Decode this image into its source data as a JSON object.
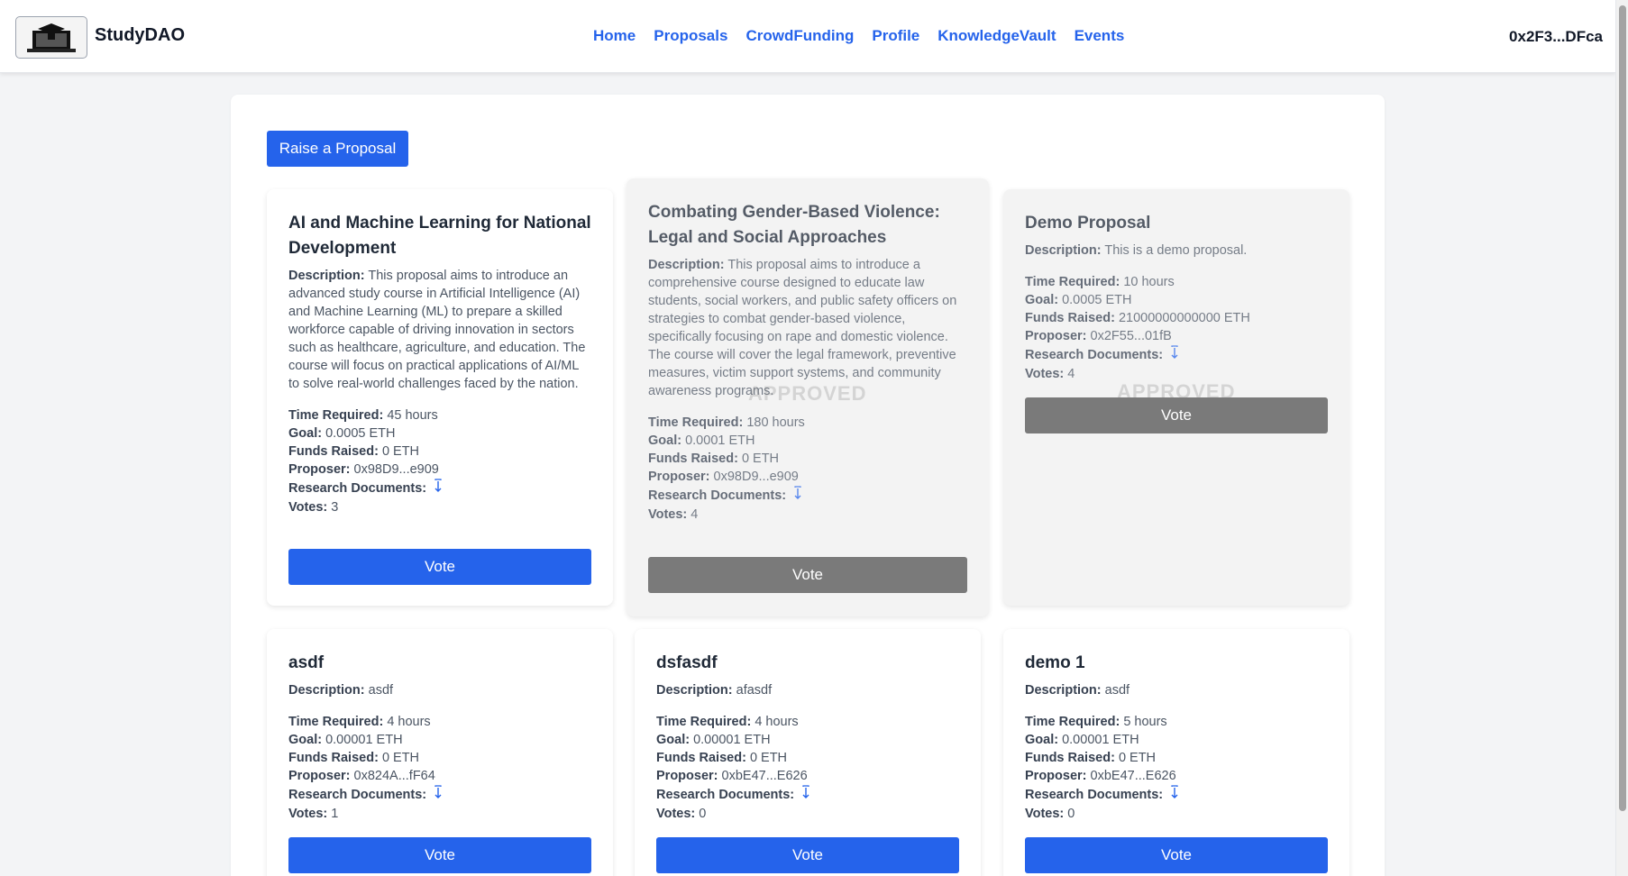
{
  "header": {
    "brand": "StudyDAO",
    "nav": [
      "Home",
      "Proposals",
      "CrowdFunding",
      "Profile",
      "KnowledgeVault",
      "Events"
    ],
    "wallet": "0x2F3...DFca"
  },
  "actions": {
    "raise_label": "Raise a Proposal"
  },
  "labels": {
    "description": "Description:",
    "time": "Time Required:",
    "goal": "Goal:",
    "funds": "Funds Raised:",
    "proposer": "Proposer:",
    "docs": "Research Documents:",
    "votes": "Votes:",
    "vote_button": "Vote",
    "approved": "APPROVED"
  },
  "proposals": [
    {
      "title": "AI and Machine Learning for National Development",
      "description": "This proposal aims to introduce an advanced study course in Artificial Intelligence (AI) and Machine Learning (ML) to prepare a skilled workforce capable of driving innovation in sectors such as healthcare, agriculture, and education. The course will focus on practical applications of AI/ML to solve real-world challenges faced by the nation.",
      "time": "45 hours",
      "goal": "0.0005 ETH",
      "funds": "0 ETH",
      "proposer": "0x98D9...e909",
      "votes": "3",
      "status": "open"
    },
    {
      "title": "Combating Gender-Based Violence: Legal and Social Approaches",
      "description": "This proposal aims to introduce a comprehensive course designed to educate law students, social workers, and public safety officers on strategies to combat gender-based violence, specifically focusing on rape and domestic violence. The course will cover the legal framework, preventive measures, victim support systems, and community awareness programs.",
      "time": "180 hours",
      "goal": "0.0001 ETH",
      "funds": "0 ETH",
      "proposer": "0x98D9...e909",
      "votes": "4",
      "status": "approved"
    },
    {
      "title": "Demo Proposal",
      "description": "This is a demo proposal.",
      "time": "10 hours",
      "goal": "0.0005 ETH",
      "funds": "21000000000000 ETH",
      "proposer": "0x2F55...01fB",
      "votes": "4",
      "status": "approved"
    },
    {
      "title": "asdf",
      "description": "asdf",
      "time": "4 hours",
      "goal": "0.00001 ETH",
      "funds": "0 ETH",
      "proposer": "0x824A...fF64",
      "votes": "1",
      "status": "open"
    },
    {
      "title": "dsfasdf",
      "description": "afasdf",
      "time": "4 hours",
      "goal": "0.00001 ETH",
      "funds": "0 ETH",
      "proposer": "0xbE47...E626",
      "votes": "0",
      "status": "open"
    },
    {
      "title": "demo 1",
      "description": "asdf",
      "time": "5 hours",
      "goal": "0.00001 ETH",
      "funds": "0 ETH",
      "proposer": "0xbE47...E626",
      "votes": "0",
      "status": "open"
    }
  ],
  "colors": {
    "primary": "#2563eb",
    "disabled": "#7a7a7a",
    "background": "#f3f4f6"
  },
  "icons": {
    "logo": "graduation-laptop-icon",
    "docs": "download-arrow-icon"
  }
}
